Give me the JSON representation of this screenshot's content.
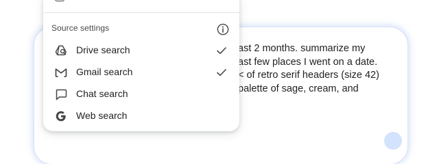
{
  "prompt": {
    "lines": [
      "ast 2 months. summarize my",
      "ast few places I went on a date.",
      "< of retro serif headers (size 42)",
      "palette of sage, cream, and"
    ]
  },
  "menu": {
    "section_title": "Source settings",
    "items": [
      {
        "label": "Drive search",
        "icon": "drive-search-icon",
        "checked": true
      },
      {
        "label": "Gmail search",
        "icon": "gmail-icon",
        "checked": true
      },
      {
        "label": "Chat search",
        "icon": "chat-icon",
        "checked": false
      },
      {
        "label": "Web search",
        "icon": "google-g-icon",
        "checked": false
      }
    ]
  },
  "colors": {
    "text": "#1f1f1f",
    "icon": "#444746",
    "glow": "#6e96eb",
    "send_button": "#d3e3fd"
  }
}
